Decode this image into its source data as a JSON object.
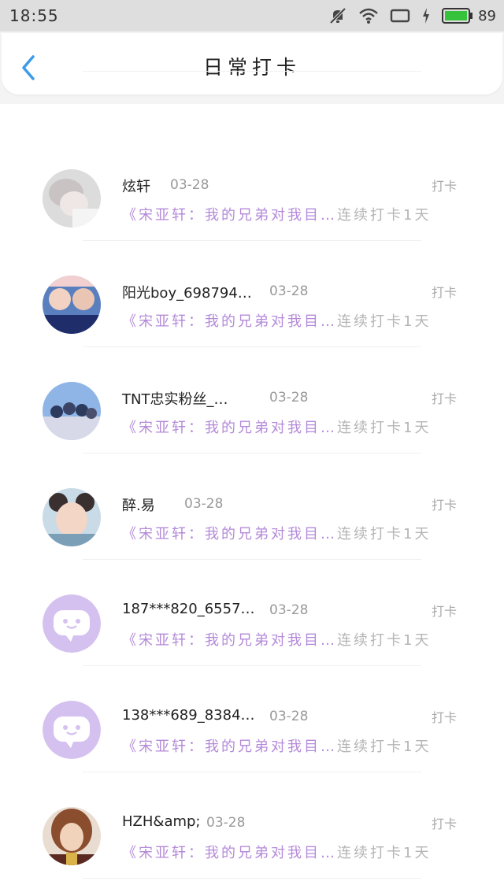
{
  "status_bar": {
    "time": "18:55",
    "battery": "89"
  },
  "header": {
    "title": "日常打卡"
  },
  "list_common": {
    "content": "《宋亚轩：我的兄弟对我目…",
    "streak": "连续打卡1天",
    "tag": "打卡"
  },
  "items": [
    {
      "name": "",
      "date": ""
    },
    {
      "name": "炫轩",
      "date": "03-28"
    },
    {
      "name": "阳光boy_698794…",
      "date": "03-28"
    },
    {
      "name": "TNT忠实粉丝_…",
      "date": "03-28"
    },
    {
      "name": "醉.易",
      "date": "03-28"
    },
    {
      "name": "187***820_6557…",
      "date": "03-28"
    },
    {
      "name": "138***689_8384…",
      "date": "03-28"
    },
    {
      "name": "HZH&amp;",
      "date": "03-28"
    }
  ],
  "colors": {
    "accent": "#3d9bea",
    "content": "#b48ad9",
    "default_avatar": "#d5c1ef"
  }
}
